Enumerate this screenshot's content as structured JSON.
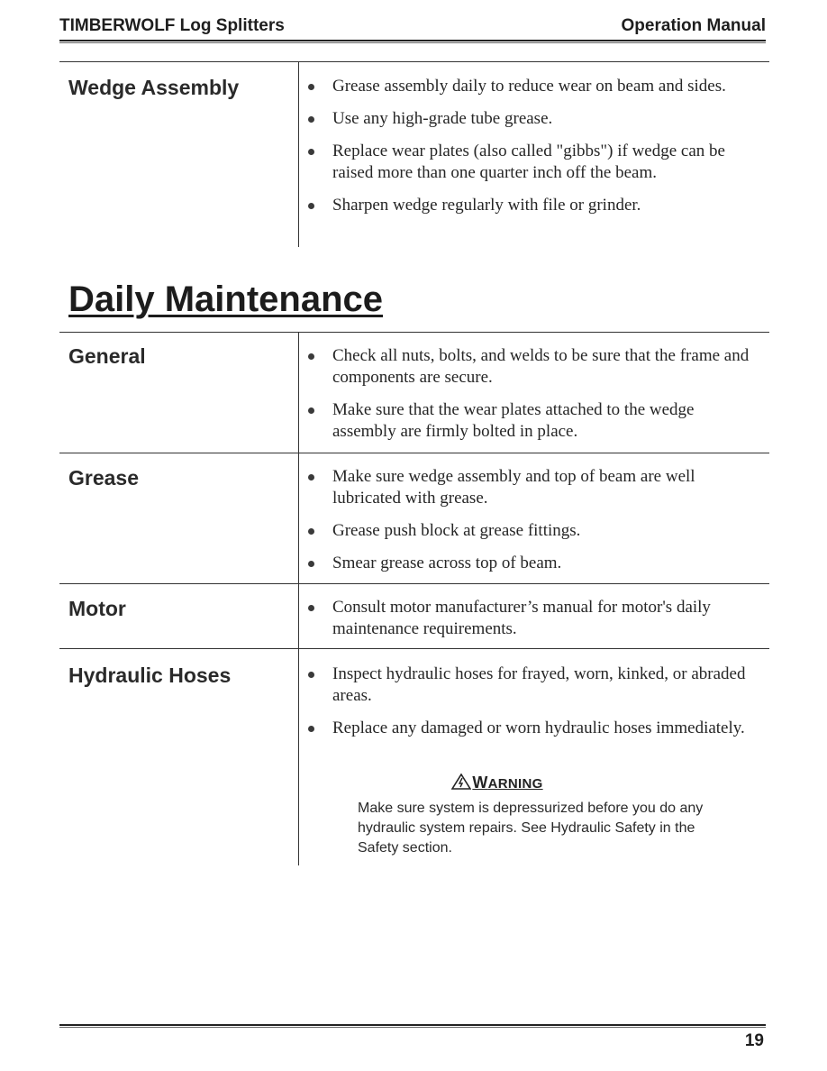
{
  "header": {
    "left_title": "TIMBERWOLF Log Splitters",
    "right_title": "Operation Manual"
  },
  "wedge_assembly": {
    "label": "Wedge Assembly",
    "bullets": [
      "Grease assembly daily to reduce wear on beam and sides.",
      "Use any high-grade tube grease.",
      "Replace wear plates (also called \"gibbs\") if wedge can be raised more than one quarter inch off the beam.",
      "Sharpen wedge regularly with file or grinder."
    ]
  },
  "daily_maintenance": {
    "title": "Daily Maintenance",
    "sections": [
      {
        "label": "General",
        "bullets": [
          "Check all nuts, bolts, and welds to be sure that the frame and components are secure.",
          "Make sure that the wear plates attached to the wedge assembly are firmly bolted in place."
        ]
      },
      {
        "label": "Grease",
        "bullets": [
          "Make sure wedge assembly and top of beam are well lubricated with grease.",
          "Grease push block at grease fittings.",
          "Smear grease across top of beam."
        ]
      },
      {
        "label": "Motor",
        "bullets": [
          "Consult motor manufacturer’s manual for motor's daily maintenance requirements."
        ]
      },
      {
        "label": "Hydraulic Hoses",
        "bullets": [
          "Inspect hydraulic hoses for frayed, worn, kinked, or abraded areas.",
          "Replace any damaged or worn hydraulic hoses immediately."
        ]
      }
    ],
    "warning": {
      "icon": "warning-triangle-icon",
      "title_first": "W",
      "title_rest": "ARNING",
      "text": "Make sure system is depressurized before you do any hydraulic system repairs. See Hydraulic Safety in the Safety section."
    }
  },
  "footer": {
    "page_number": "19"
  }
}
